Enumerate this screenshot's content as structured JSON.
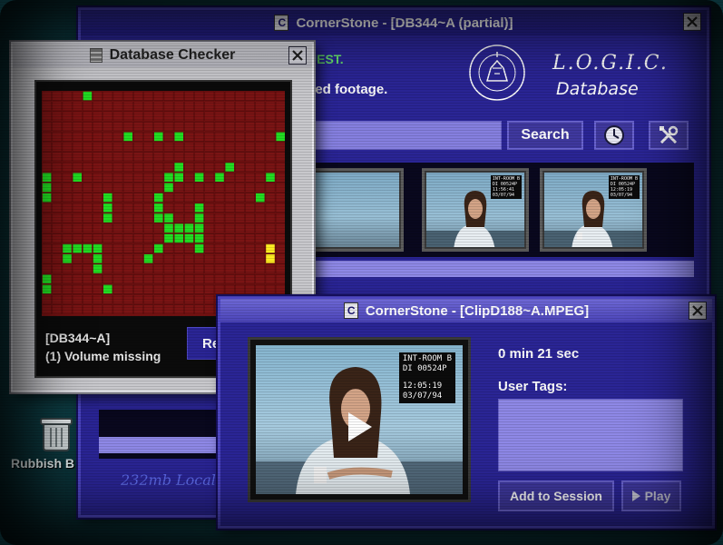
{
  "desktop": {
    "rubbish_label": "Rubbish B"
  },
  "main_window": {
    "title": "CornerStone - [DB344~A (partial)]",
    "hint_line_1": "UEST.",
    "hint_line_2": "ved footage.",
    "logo": {
      "seal_text": "NORTH EAST CONSTABULARY",
      "title": "L.O.G.I.C.",
      "subtitle": "Database"
    },
    "search": {
      "button_label": "Search",
      "value": ""
    },
    "storage_label": "232mb Local",
    "thumbnails": [
      {
        "overlay": "INT-ROOM B\nDI 00524P\n11:56:41\n03/07/94"
      },
      {
        "overlay": "INT-ROOM B\nDI 00524P\n12:05:19\n03/07/94"
      }
    ]
  },
  "checker_window": {
    "title": "Database Checker",
    "status_db": "[DB344~A]",
    "status_msg": "(1) Volume missing",
    "repair_label": "Re",
    "colors": {
      "ok": "#22dd22",
      "bad": "#7a1414",
      "warn": "#ffee22"
    }
  },
  "clip_window": {
    "title": "CornerStone - [ClipD188~A.MPEG]",
    "overlay_room": "INT-ROOM B",
    "overlay_id": "DI 00524P",
    "overlay_time": "12:05:19",
    "overlay_date": "03/07/94",
    "duration": "0 min 21 sec",
    "tags_label": "User Tags:",
    "tags_value": "",
    "add_button": "Add to Session",
    "play_button": "Play"
  }
}
